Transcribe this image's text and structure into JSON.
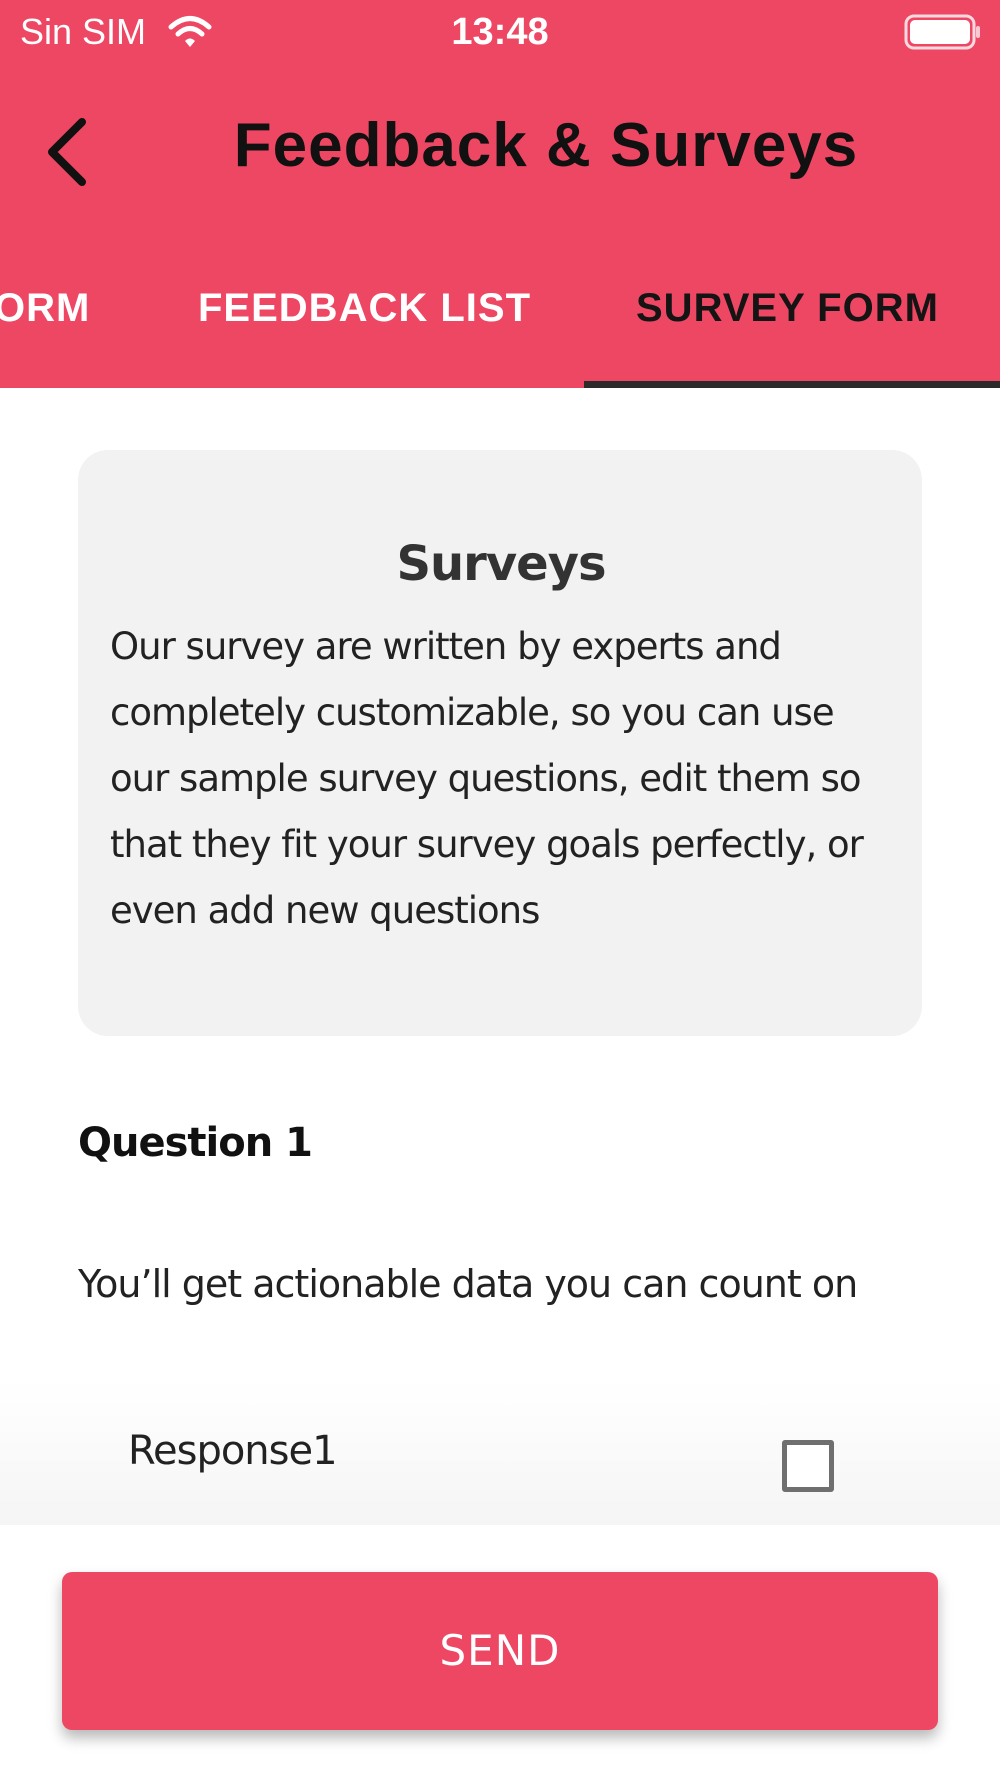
{
  "status_bar": {
    "carrier": "Sin SIM",
    "time": "13:48",
    "icons": [
      "wifi-icon",
      "battery-icon"
    ]
  },
  "header": {
    "title": "Feedback & Surveys",
    "back_icon": "chevron-left-icon"
  },
  "tabs": [
    {
      "label": "ORM",
      "selected": false
    },
    {
      "label": "FEEDBACK LIST",
      "selected": false
    },
    {
      "label": "SURVEY FORM",
      "selected": true
    }
  ],
  "info_card": {
    "title": "Surveys",
    "body": "Our survey are written by experts and completely customizable, so you can use our sample survey questions, edit them so that they fit your survey goals perfectly, or even add new questions"
  },
  "question": {
    "title": "Question 1",
    "text": "You’ll get actionable data you can count on",
    "responses": [
      {
        "label": "Response1",
        "checked": false
      }
    ]
  },
  "send_button": {
    "label": "SEND"
  },
  "colors": {
    "accent": "#ee4763",
    "tab_indicator": "#2b2b2b",
    "card_background": "#f2f2f2"
  }
}
